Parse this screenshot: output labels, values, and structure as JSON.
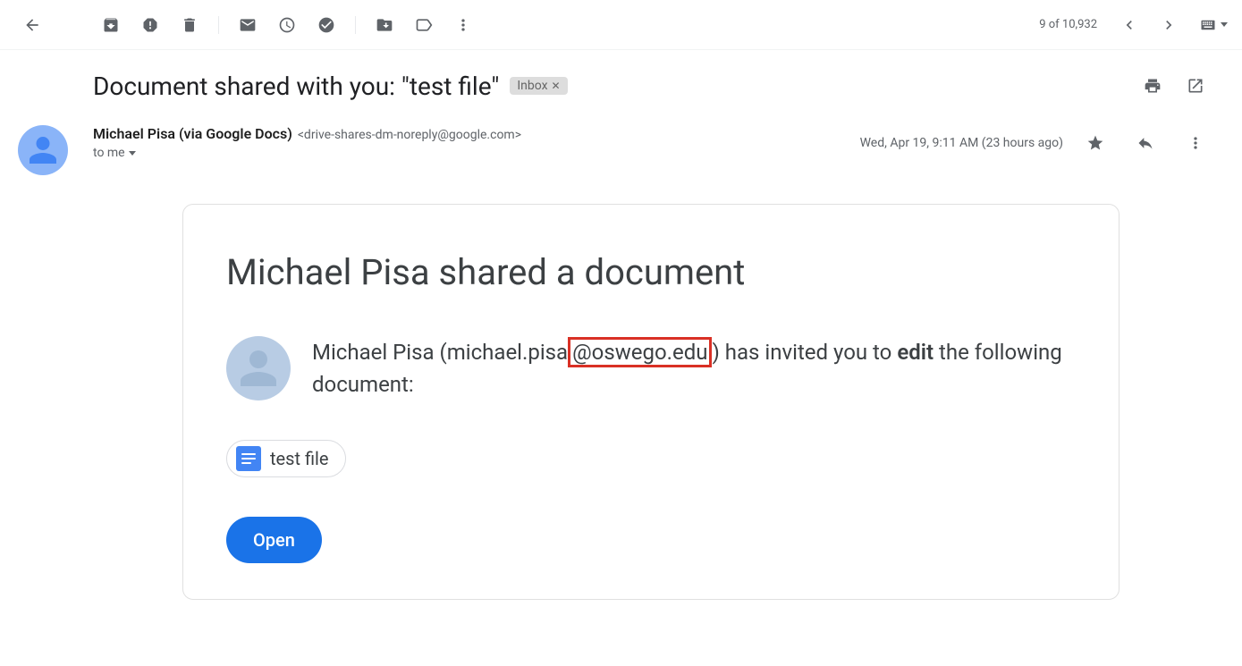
{
  "toolbar": {
    "count": "9 of 10,932"
  },
  "subject": "Document shared with you: \"test file\"",
  "label": "Inbox",
  "sender": {
    "name": "Michael Pisa (via Google Docs)",
    "email": "<drive-shares-dm-noreply@google.com>",
    "to": "to me"
  },
  "meta": {
    "date": "Wed, Apr 19, 9:11 AM (23 hours ago)"
  },
  "card": {
    "title": "Michael Pisa shared a document",
    "invite_prefix": "Michael Pisa (michael.pisa",
    "invite_highlight": "@oswego.edu",
    "invite_mid": ") has invited you to ",
    "invite_bold": "edit",
    "invite_suffix": " the following document:",
    "file": "test file",
    "open": "Open"
  }
}
